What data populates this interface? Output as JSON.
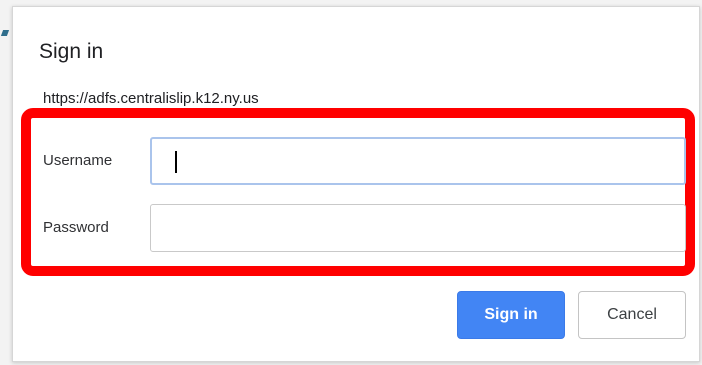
{
  "dialog": {
    "title": "Sign in",
    "origin": "https://adfs.centralislip.k12.ny.us"
  },
  "form": {
    "username_label": "Username",
    "username_value": "",
    "password_label": "Password",
    "password_value": ""
  },
  "buttons": {
    "sign_in_label": "Sign in",
    "cancel_label": "Cancel"
  },
  "colors": {
    "primary_button": "#4285f4",
    "highlight_box": "#ff0000",
    "focused_input_border": "#aac4ec"
  }
}
